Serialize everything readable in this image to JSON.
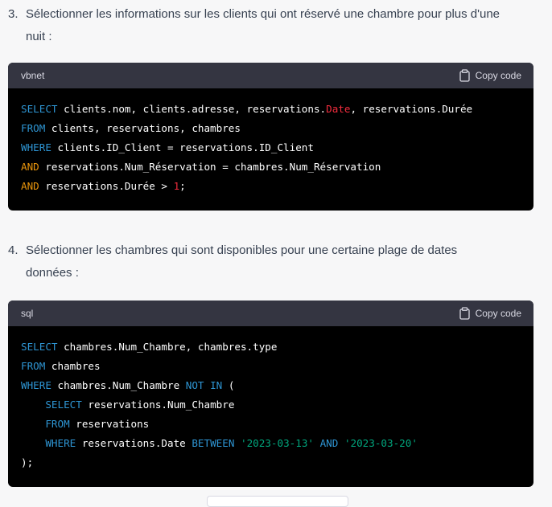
{
  "item3": {
    "number": "3.",
    "line1": "Sélectionner les informations sur les clients qui ont réservé une chambre pour plus d'une",
    "line2": "nuit :"
  },
  "code1": {
    "language": "vbnet",
    "copy_label": "Copy code",
    "lines": [
      [
        {
          "t": "SELECT",
          "c": "kw"
        },
        {
          "t": " clients.nom, clients.adresse, reservations.",
          "c": ""
        },
        {
          "t": "Date",
          "c": "op"
        },
        {
          "t": ", reservations.Durée",
          "c": ""
        }
      ],
      [
        {
          "t": "FROM",
          "c": "kw"
        },
        {
          "t": " clients, reservations, chambres",
          "c": ""
        }
      ],
      [
        {
          "t": "WHERE",
          "c": "kw"
        },
        {
          "t": " clients.ID_Client = reservations.ID_Client",
          "c": ""
        }
      ],
      [
        {
          "t": "AND",
          "c": "and"
        },
        {
          "t": " reservations.Num_Réservation = chambres.Num_Réservation",
          "c": ""
        }
      ],
      [
        {
          "t": "AND",
          "c": "and"
        },
        {
          "t": " reservations.Durée > ",
          "c": ""
        },
        {
          "t": "1",
          "c": "op"
        },
        {
          "t": ";",
          "c": ""
        }
      ]
    ]
  },
  "item4": {
    "number": "4.",
    "line1": "Sélectionner les chambres qui sont disponibles pour une certaine plage de dates",
    "line2": "données :"
  },
  "code2": {
    "language": "sql",
    "copy_label": "Copy code",
    "lines": [
      [
        {
          "t": "SELECT",
          "c": "kw"
        },
        {
          "t": " chambres.Num_Chambre, chambres.type",
          "c": ""
        }
      ],
      [
        {
          "t": "FROM",
          "c": "kw"
        },
        {
          "t": " chambres",
          "c": ""
        }
      ],
      [
        {
          "t": "WHERE",
          "c": "kw"
        },
        {
          "t": " chambres.Num_Chambre ",
          "c": ""
        },
        {
          "t": "NOT",
          "c": "kw"
        },
        {
          "t": " ",
          "c": ""
        },
        {
          "t": "IN",
          "c": "kw"
        },
        {
          "t": " (",
          "c": ""
        }
      ],
      [
        {
          "t": "    ",
          "c": ""
        },
        {
          "t": "SELECT",
          "c": "kw"
        },
        {
          "t": " reservations.Num_Chambre",
          "c": ""
        }
      ],
      [
        {
          "t": "    ",
          "c": ""
        },
        {
          "t": "FROM",
          "c": "kw"
        },
        {
          "t": " reservations",
          "c": ""
        }
      ],
      [
        {
          "t": "    ",
          "c": ""
        },
        {
          "t": "WHERE",
          "c": "kw"
        },
        {
          "t": " reservations.Date ",
          "c": ""
        },
        {
          "t": "BETWEEN",
          "c": "kw"
        },
        {
          "t": " ",
          "c": ""
        },
        {
          "t": "'2023-03-13'",
          "c": "str"
        },
        {
          "t": " ",
          "c": ""
        },
        {
          "t": "AND",
          "c": "kw"
        },
        {
          "t": " ",
          "c": ""
        },
        {
          "t": "'2023-03-20'",
          "c": "str"
        }
      ],
      [
        {
          "t": ");",
          "c": ""
        }
      ]
    ]
  },
  "icons": {
    "copy": "clipboard-icon"
  }
}
